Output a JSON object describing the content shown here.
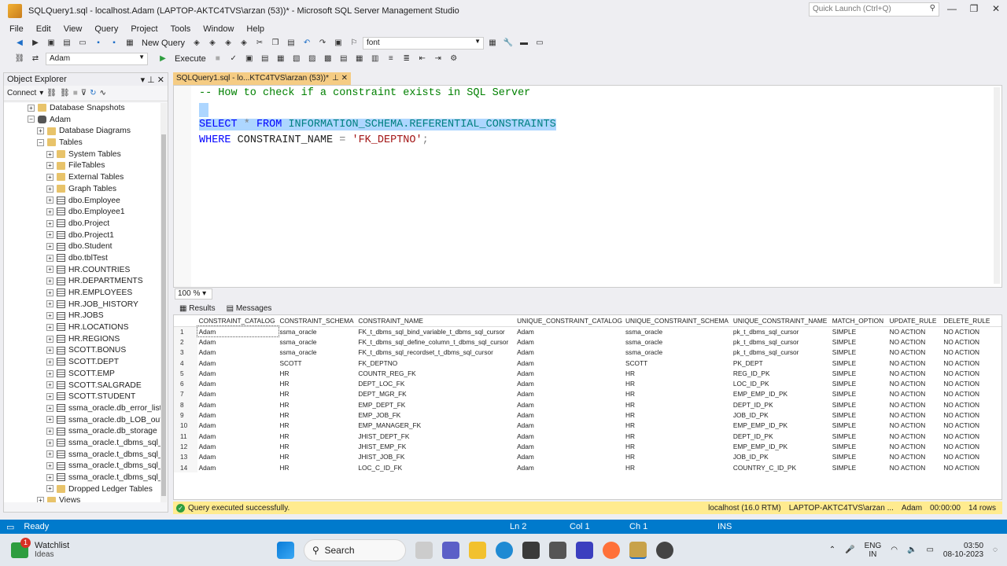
{
  "window": {
    "title": "SQLQuery1.sql - localhost.Adam (LAPTOP-AKTC4TVS\\arzan (53))* - Microsoft SQL Server Management Studio",
    "quick_launch": "Quick Launch (Ctrl+Q)"
  },
  "menu": [
    "File",
    "Edit",
    "View",
    "Query",
    "Project",
    "Tools",
    "Window",
    "Help"
  ],
  "toolbar": {
    "new_query": "New Query",
    "font_combo": "font",
    "db_combo": "Adam",
    "execute": "Execute"
  },
  "object_explorer": {
    "title": "Object Explorer",
    "connect": "Connect",
    "nodes": [
      {
        "label": "Database Snapshots",
        "indent": 2,
        "icon": "folder",
        "exp": "+"
      },
      {
        "label": "Adam",
        "indent": 2,
        "icon": "db",
        "exp": "−"
      },
      {
        "label": "Database Diagrams",
        "indent": 3,
        "icon": "folder",
        "exp": "+"
      },
      {
        "label": "Tables",
        "indent": 3,
        "icon": "folder",
        "exp": "−"
      },
      {
        "label": "System Tables",
        "indent": 4,
        "icon": "folder",
        "exp": "+"
      },
      {
        "label": "FileTables",
        "indent": 4,
        "icon": "folder",
        "exp": "+"
      },
      {
        "label": "External Tables",
        "indent": 4,
        "icon": "folder",
        "exp": "+"
      },
      {
        "label": "Graph Tables",
        "indent": 4,
        "icon": "folder",
        "exp": "+"
      },
      {
        "label": "dbo.Employee",
        "indent": 4,
        "icon": "table",
        "exp": "+"
      },
      {
        "label": "dbo.Employee1",
        "indent": 4,
        "icon": "table",
        "exp": "+"
      },
      {
        "label": "dbo.Project",
        "indent": 4,
        "icon": "table",
        "exp": "+"
      },
      {
        "label": "dbo.Project1",
        "indent": 4,
        "icon": "table",
        "exp": "+"
      },
      {
        "label": "dbo.Student",
        "indent": 4,
        "icon": "table",
        "exp": "+"
      },
      {
        "label": "dbo.tblTest",
        "indent": 4,
        "icon": "table",
        "exp": "+"
      },
      {
        "label": "HR.COUNTRIES",
        "indent": 4,
        "icon": "table",
        "exp": "+"
      },
      {
        "label": "HR.DEPARTMENTS",
        "indent": 4,
        "icon": "table",
        "exp": "+"
      },
      {
        "label": "HR.EMPLOYEES",
        "indent": 4,
        "icon": "table",
        "exp": "+"
      },
      {
        "label": "HR.JOB_HISTORY",
        "indent": 4,
        "icon": "table",
        "exp": "+"
      },
      {
        "label": "HR.JOBS",
        "indent": 4,
        "icon": "table",
        "exp": "+"
      },
      {
        "label": "HR.LOCATIONS",
        "indent": 4,
        "icon": "table",
        "exp": "+"
      },
      {
        "label": "HR.REGIONS",
        "indent": 4,
        "icon": "table",
        "exp": "+"
      },
      {
        "label": "SCOTT.BONUS",
        "indent": 4,
        "icon": "table",
        "exp": "+"
      },
      {
        "label": "SCOTT.DEPT",
        "indent": 4,
        "icon": "table",
        "exp": "+"
      },
      {
        "label": "SCOTT.EMP",
        "indent": 4,
        "icon": "table",
        "exp": "+"
      },
      {
        "label": "SCOTT.SALGRADE",
        "indent": 4,
        "icon": "table",
        "exp": "+"
      },
      {
        "label": "SCOTT.STUDENT",
        "indent": 4,
        "icon": "table",
        "exp": "+"
      },
      {
        "label": "ssma_oracle.db_error_list",
        "indent": 4,
        "icon": "table",
        "exp": "+"
      },
      {
        "label": "ssma_oracle.db_LOB_outp",
        "indent": 4,
        "icon": "table",
        "exp": "+"
      },
      {
        "label": "ssma_oracle.db_storage",
        "indent": 4,
        "icon": "table",
        "exp": "+"
      },
      {
        "label": "ssma_oracle.t_dbms_sql_b",
        "indent": 4,
        "icon": "table",
        "exp": "+"
      },
      {
        "label": "ssma_oracle.t_dbms_sql_c",
        "indent": 4,
        "icon": "table",
        "exp": "+"
      },
      {
        "label": "ssma_oracle.t_dbms_sql_d",
        "indent": 4,
        "icon": "table",
        "exp": "+"
      },
      {
        "label": "ssma_oracle.t_dbms_sql_re",
        "indent": 4,
        "icon": "table",
        "exp": "+"
      },
      {
        "label": "Dropped Ledger Tables",
        "indent": 4,
        "icon": "folder",
        "exp": "+"
      },
      {
        "label": "Views",
        "indent": 3,
        "icon": "folder",
        "exp": "+"
      }
    ]
  },
  "editor": {
    "tab": "SQLQuery1.sql - lo...KTC4TVS\\arzan (53))*",
    "zoom": "100 %",
    "line1": "-- How to check if a constraint exists in SQL Server",
    "l3_select": "SELECT",
    "l3_star": "*",
    "l3_from": "FROM",
    "l3_obj": "INFORMATION_SCHEMA.REFERENTIAL_CONSTRAINTS",
    "l4_where": "WHERE",
    "l4_col": "CONSTRAINT_NAME",
    "l4_eq": "=",
    "l4_val": "'FK_DEPTNO'",
    "l4_semi": ";"
  },
  "results": {
    "tab_results": "Results",
    "tab_messages": "Messages",
    "columns": [
      "CONSTRAINT_CATALOG",
      "CONSTRAINT_SCHEMA",
      "CONSTRAINT_NAME",
      "UNIQUE_CONSTRAINT_CATALOG",
      "UNIQUE_CONSTRAINT_SCHEMA",
      "UNIQUE_CONSTRAINT_NAME",
      "MATCH_OPTION",
      "UPDATE_RULE",
      "DELETE_RULE"
    ],
    "rows": [
      [
        "1",
        "Adam",
        "ssma_oracle",
        "FK_t_dbms_sql_bind_variable_t_dbms_sql_cursor",
        "Adam",
        "ssma_oracle",
        "pk_t_dbms_sql_cursor",
        "SIMPLE",
        "NO ACTION",
        "NO ACTION"
      ],
      [
        "2",
        "Adam",
        "ssma_oracle",
        "FK_t_dbms_sql_define_column_t_dbms_sql_cursor",
        "Adam",
        "ssma_oracle",
        "pk_t_dbms_sql_cursor",
        "SIMPLE",
        "NO ACTION",
        "NO ACTION"
      ],
      [
        "3",
        "Adam",
        "ssma_oracle",
        "FK_t_dbms_sql_recordset_t_dbms_sql_cursor",
        "Adam",
        "ssma_oracle",
        "pk_t_dbms_sql_cursor",
        "SIMPLE",
        "NO ACTION",
        "NO ACTION"
      ],
      [
        "4",
        "Adam",
        "SCOTT",
        "FK_DEPTNO",
        "Adam",
        "SCOTT",
        "PK_DEPT",
        "SIMPLE",
        "NO ACTION",
        "NO ACTION"
      ],
      [
        "5",
        "Adam",
        "HR",
        "COUNTR_REG_FK",
        "Adam",
        "HR",
        "REG_ID_PK",
        "SIMPLE",
        "NO ACTION",
        "NO ACTION"
      ],
      [
        "6",
        "Adam",
        "HR",
        "DEPT_LOC_FK",
        "Adam",
        "HR",
        "LOC_ID_PK",
        "SIMPLE",
        "NO ACTION",
        "NO ACTION"
      ],
      [
        "7",
        "Adam",
        "HR",
        "DEPT_MGR_FK",
        "Adam",
        "HR",
        "EMP_EMP_ID_PK",
        "SIMPLE",
        "NO ACTION",
        "NO ACTION"
      ],
      [
        "8",
        "Adam",
        "HR",
        "EMP_DEPT_FK",
        "Adam",
        "HR",
        "DEPT_ID_PK",
        "SIMPLE",
        "NO ACTION",
        "NO ACTION"
      ],
      [
        "9",
        "Adam",
        "HR",
        "EMP_JOB_FK",
        "Adam",
        "HR",
        "JOB_ID_PK",
        "SIMPLE",
        "NO ACTION",
        "NO ACTION"
      ],
      [
        "10",
        "Adam",
        "HR",
        "EMP_MANAGER_FK",
        "Adam",
        "HR",
        "EMP_EMP_ID_PK",
        "SIMPLE",
        "NO ACTION",
        "NO ACTION"
      ],
      [
        "11",
        "Adam",
        "HR",
        "JHIST_DEPT_FK",
        "Adam",
        "HR",
        "DEPT_ID_PK",
        "SIMPLE",
        "NO ACTION",
        "NO ACTION"
      ],
      [
        "12",
        "Adam",
        "HR",
        "JHIST_EMP_FK",
        "Adam",
        "HR",
        "EMP_EMP_ID_PK",
        "SIMPLE",
        "NO ACTION",
        "NO ACTION"
      ],
      [
        "13",
        "Adam",
        "HR",
        "JHIST_JOB_FK",
        "Adam",
        "HR",
        "JOB_ID_PK",
        "SIMPLE",
        "NO ACTION",
        "NO ACTION"
      ],
      [
        "14",
        "Adam",
        "HR",
        "LOC_C_ID_FK",
        "Adam",
        "HR",
        "COUNTRY_C_ID_PK",
        "SIMPLE",
        "NO ACTION",
        "NO ACTION"
      ]
    ]
  },
  "query_status": {
    "message": "Query executed successfully.",
    "server": "localhost (16.0 RTM)",
    "login": "LAPTOP-AKTC4TVS\\arzan ...",
    "db": "Adam",
    "time": "00:00:00",
    "rows": "14 rows"
  },
  "app_status": {
    "ready": "Ready",
    "ln": "Ln 2",
    "col": "Col 1",
    "ch": "Ch 1",
    "ins": "INS"
  },
  "taskbar": {
    "widget_title": "Watchlist",
    "widget_sub": "Ideas",
    "widget_badge": "1",
    "search": "Search",
    "lang1": "ENG",
    "lang2": "IN",
    "time": "03:50",
    "date": "08-10-2023"
  },
  "colors": {
    "accent": "#007acc",
    "tab_active": "#f5cc84",
    "status_bar": "#ffeb8f"
  }
}
